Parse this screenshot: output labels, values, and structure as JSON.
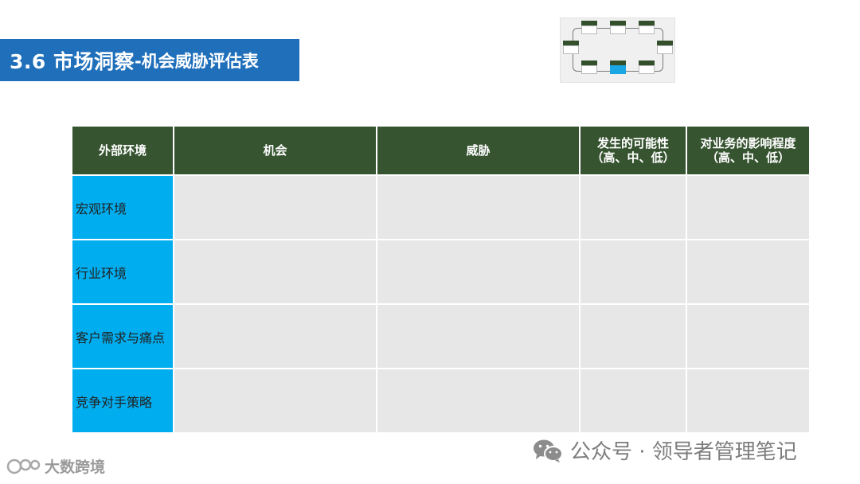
{
  "title": {
    "main": "3.6 市场洞察",
    "sub": "-机会威胁评估表"
  },
  "thumbnail": {
    "icon": "process-flow-thumbnail",
    "highlight_color": "#1aa7e4",
    "step_color": "#344f2c"
  },
  "table": {
    "headers": [
      "外部环境",
      "机会",
      "威胁",
      "发生的可能性（高、中、低）",
      "对业务的影响程度（高、中、低）"
    ],
    "rows": [
      {
        "label": "宏观环境",
        "cells": [
          "",
          "",
          "",
          ""
        ]
      },
      {
        "label": "行业环境",
        "cells": [
          "",
          "",
          "",
          ""
        ]
      },
      {
        "label": "客户需求与痛点",
        "cells": [
          "",
          "",
          "",
          ""
        ]
      },
      {
        "label": "竞争对手策略",
        "cells": [
          "",
          "",
          "",
          ""
        ]
      }
    ],
    "colors": {
      "header_bg": "#375431",
      "rowhead_bg": "#00adef",
      "cell_bg": "#e7e7e7"
    }
  },
  "watermark": {
    "icon": "wechat-icon",
    "text": "公众号 · 领导者管理笔记"
  },
  "brand": {
    "icon": "brand-logo-icon",
    "text": "大数跨境"
  }
}
